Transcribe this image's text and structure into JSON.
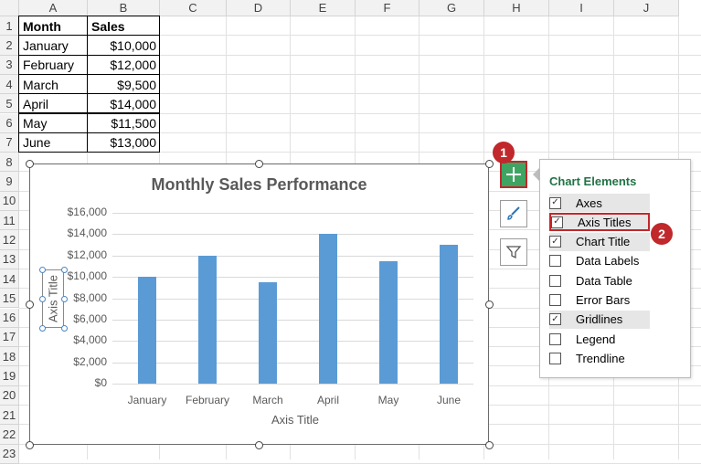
{
  "sheet": {
    "columns": [
      "A",
      "B",
      "C",
      "D",
      "E",
      "F",
      "G",
      "H",
      "I",
      "J"
    ],
    "rows": [
      "1",
      "2",
      "3",
      "4",
      "5",
      "6",
      "7",
      "8",
      "9",
      "10",
      "11",
      "12",
      "13",
      "14",
      "15",
      "16",
      "17",
      "18",
      "19",
      "20",
      "21",
      "22",
      "23"
    ],
    "table": {
      "headers": [
        "Month",
        "Sales"
      ],
      "data": [
        [
          "January",
          "$10,000"
        ],
        [
          "February",
          "$12,000"
        ],
        [
          "March",
          "$9,500"
        ],
        [
          "April",
          "$14,000"
        ],
        [
          "May",
          "$11,500"
        ],
        [
          "June",
          "$13,000"
        ]
      ]
    }
  },
  "chart_data": {
    "type": "bar",
    "title": "Monthly Sales Performance",
    "categories": [
      "January",
      "February",
      "March",
      "April",
      "May",
      "June"
    ],
    "values": [
      10000,
      12000,
      9500,
      14000,
      11500,
      13000
    ],
    "xlabel": "Axis Title",
    "ylabel": "Axis Title",
    "ylim": [
      0,
      16000
    ],
    "yticks": [
      "$0",
      "$2,000",
      "$4,000",
      "$6,000",
      "$8,000",
      "$10,000",
      "$12,000",
      "$14,000",
      "$16,000"
    ],
    "grid": true,
    "color": "#5b9bd5"
  },
  "panel": {
    "title": "Chart Elements",
    "options": [
      {
        "label": "Axes",
        "checked": true
      },
      {
        "label": "Axis Titles",
        "checked": true
      },
      {
        "label": "Chart Title",
        "checked": true
      },
      {
        "label": "Data Labels",
        "checked": false
      },
      {
        "label": "Data Table",
        "checked": false
      },
      {
        "label": "Error Bars",
        "checked": false
      },
      {
        "label": "Gridlines",
        "checked": true
      },
      {
        "label": "Legend",
        "checked": false
      },
      {
        "label": "Trendline",
        "checked": false
      }
    ]
  },
  "side_buttons": [
    "plus-icon",
    "brush-icon",
    "filter-icon"
  ],
  "callouts": [
    "1",
    "2"
  ],
  "colors": {
    "accent": "#c0282b",
    "bar": "#5b9bd5",
    "panel_title": "#217346",
    "elements_button": "#3fa462"
  }
}
